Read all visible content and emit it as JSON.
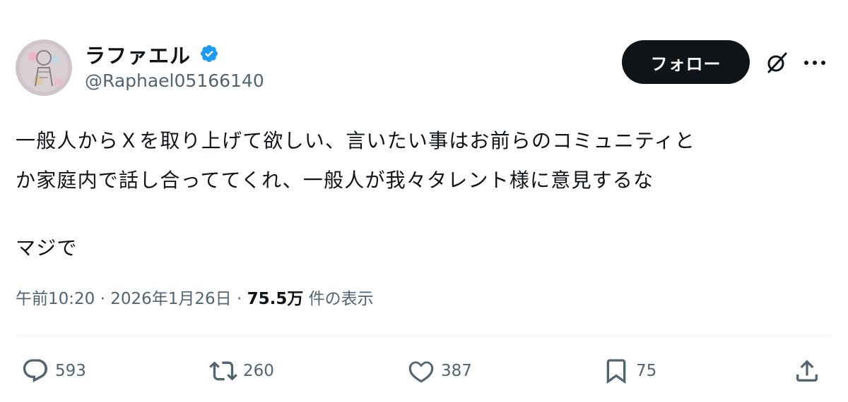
{
  "user": {
    "display_name": "ラファエル",
    "handle": "@Raphael05166140",
    "follow_label": "フォロー"
  },
  "tweet": {
    "lines": [
      "一般人からＸを取り上げて欲しい、言いたい事はお前らのコミュニティと",
      "か家庭内で話し合っててくれ、一般人が我々タレント様に意見するな",
      "マジで"
    ],
    "time": "午前10:20",
    "separator1": " · ",
    "date": "2026年1月26日",
    "separator2": " · ",
    "views": "75.5万",
    "views_suffix": " 件の表示"
  },
  "actions": {
    "reply_count": "593",
    "retweet_count": "260",
    "like_count": "387",
    "bookmark_count": "75"
  },
  "colors": {
    "text": "#0f1419",
    "secondary": "#536471",
    "verified": "#1d9bf0",
    "follow_bg": "#0f1419"
  },
  "icons": [
    "verified-badge-icon",
    "grok-icon",
    "more-icon",
    "reply-icon",
    "retweet-icon",
    "like-icon",
    "bookmark-icon",
    "share-icon"
  ]
}
